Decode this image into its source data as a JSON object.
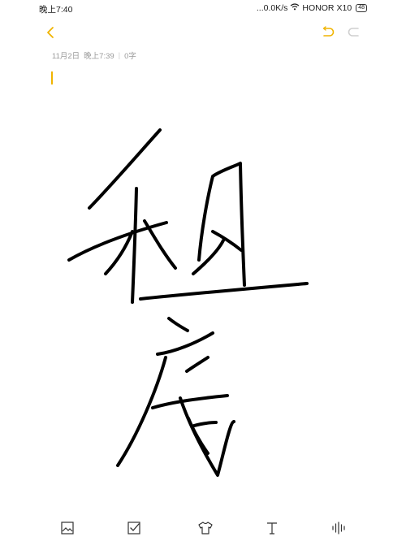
{
  "status": {
    "time": "晚上7:40",
    "signal_text": "...0.0K/s",
    "carrier": "HONOR",
    "model": "X10",
    "battery": "48"
  },
  "note": {
    "date": "11月2日",
    "time": "晚上7:39",
    "word_count": "0字",
    "handwriting_chars": [
      "租",
      "房"
    ]
  },
  "colors": {
    "accent": "#f0b400",
    "ink": "#000000",
    "meta_text": "#9a9a9a"
  },
  "toolbar": {
    "icons": [
      "back-icon",
      "undo-icon",
      "redo-icon"
    ]
  },
  "bottom_toolbar": {
    "icons": [
      "image-icon",
      "checkbox-icon",
      "shirt-theme-icon",
      "text-format-icon",
      "audio-icon"
    ]
  }
}
